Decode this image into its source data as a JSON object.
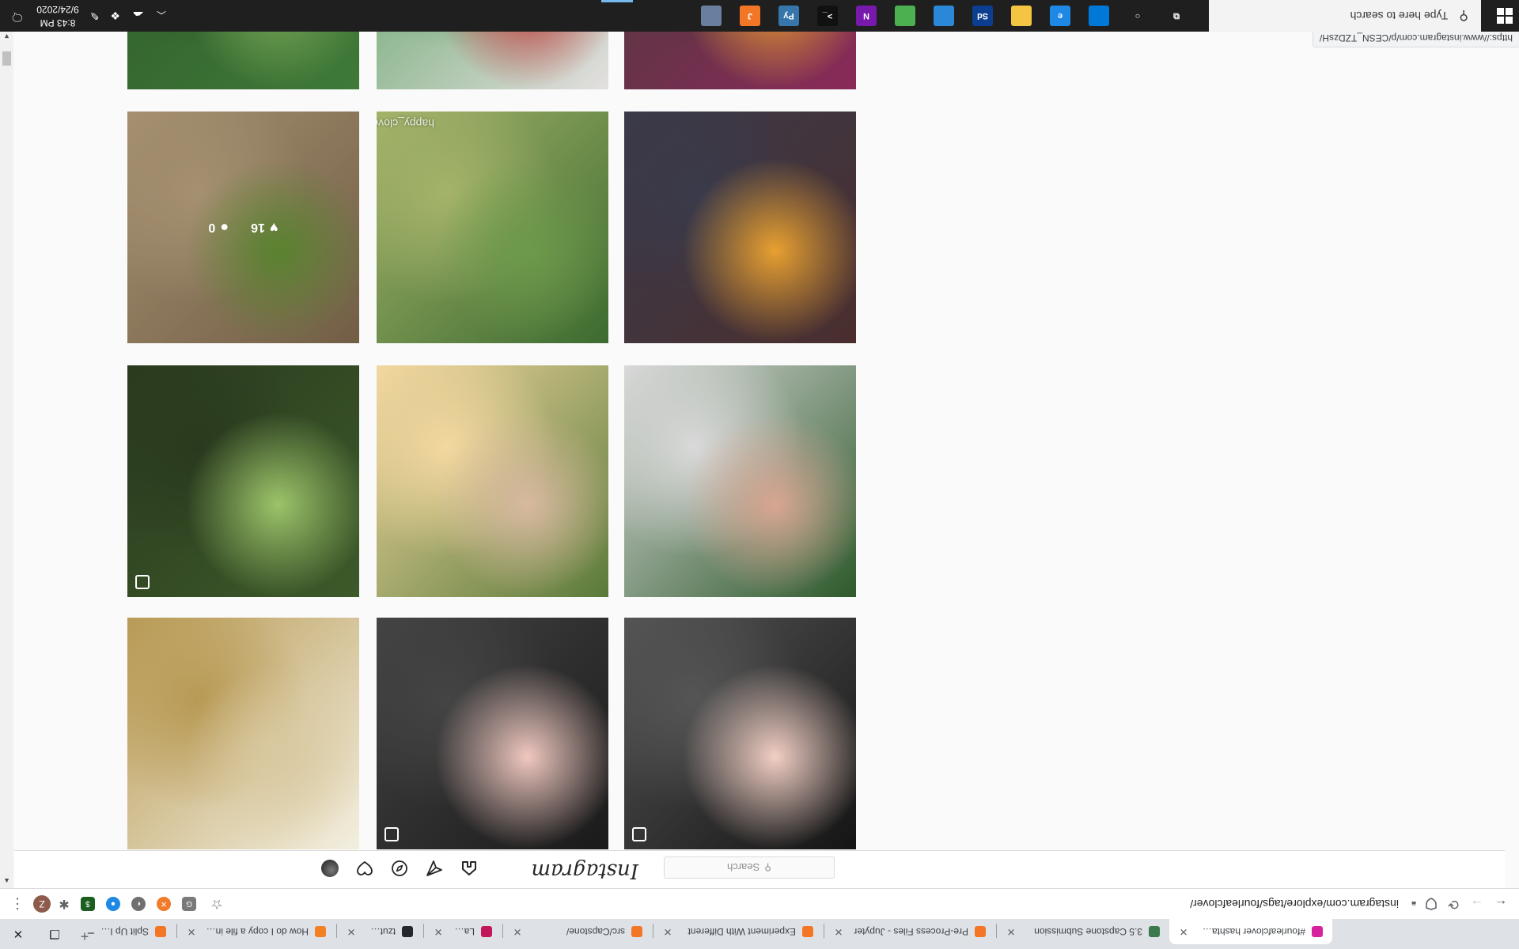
{
  "browser": {
    "tabs": [
      {
        "title": "#fourleafclover hashtag on",
        "favicon_color": "#d6249f",
        "active": true
      },
      {
        "title": "3.5 Capstone Submission",
        "favicon_color": "#3c7a4d",
        "active": false
      },
      {
        "title": "Pre-Process Files - Jupyter",
        "favicon_color": "#f37626",
        "active": false
      },
      {
        "title": "Experiment With Different",
        "favicon_color": "#f37626",
        "active": false
      },
      {
        "title": "src/Capstone/",
        "favicon_color": "#f37626",
        "active": false
      },
      {
        "title": "Label",
        "favicon_color": "#c2185b",
        "active": false
      },
      {
        "title": "tzutalin/labelImg: LabelImg",
        "favicon_color": "#24292e",
        "active": false
      },
      {
        "title": "How do I copy a file in Pyth",
        "favicon_color": "#f48024",
        "active": false
      },
      {
        "title": "Split Up Images - Jupyter N",
        "favicon_color": "#f37626",
        "active": false
      }
    ],
    "window_controls": {
      "minimize": "–",
      "maximize": "❐",
      "close": "✕"
    },
    "address_bar": {
      "url": "instagram.com/explore/tags/fourleafclover/"
    },
    "profile_initial": "Z",
    "status_url": "https://www.instagram.com/p/CESN_TZDzsH/"
  },
  "instagram": {
    "logo": "Instagram",
    "search_placeholder": "Search",
    "posts": [
      {
        "colors": [
          "#f3efe0",
          "#d9c9a0",
          "#b89a55"
        ],
        "multi": false
      },
      {
        "colors": [
          "#1a1a1a",
          "#f0c8c0",
          "#444"
        ],
        "multi": true
      },
      {
        "colors": [
          "#151515",
          "#f2cfc4",
          "#555"
        ],
        "multi": true
      },
      {
        "colors": [
          "#3d5a2a",
          "#9cc46a",
          "#2a3a1e"
        ],
        "multi": true
      },
      {
        "colors": [
          "#5a7a3a",
          "#d8b9a0",
          "#f3d8a0"
        ],
        "multi": false
      },
      {
        "colors": [
          "#2e5a2c",
          "#d8a692",
          "#d9d9d9"
        ],
        "multi": false
      },
      {
        "colors": [
          "#8b7355",
          "#6da03a",
          "#c9b08a"
        ],
        "multi": false,
        "likes": "16",
        "comments": "0"
      },
      {
        "colors": [
          "#3c6b30",
          "#6d9a4a",
          "#a5b36a"
        ],
        "multi": false,
        "caption": "happy_clover 4"
      },
      {
        "colors": [
          "#4a2e2e",
          "#e8a030",
          "#3a3a4a"
        ],
        "multi": false
      },
      {
        "colors": [
          "#3f7a38",
          "#7aa858",
          "#2e5a2a"
        ],
        "multi": false
      },
      {
        "colors": [
          "#e4dfe0",
          "#c03a3a",
          "#5aa060"
        ],
        "multi": false
      },
      {
        "colors": [
          "#8a2a5a",
          "#e89a30",
          "#4a3a3a"
        ],
        "multi": false
      }
    ]
  },
  "taskbar": {
    "search_placeholder": "Type here to search",
    "clock_time": "8:43 PM",
    "clock_date": "9/24/2020",
    "pinned": [
      {
        "name": "task-view",
        "color": "transparent",
        "glyph": "⧉"
      },
      {
        "name": "cortana",
        "color": "transparent",
        "glyph": "○"
      },
      {
        "name": "windows-store",
        "color": "#0078d7",
        "glyph": ""
      },
      {
        "name": "edge",
        "color": "#1e88e5",
        "glyph": "e"
      },
      {
        "name": "file-explorer",
        "color": "#f4c542",
        "glyph": ""
      },
      {
        "name": "photoshop",
        "color": "#0b3d91",
        "glyph": "Sd"
      },
      {
        "name": "photos",
        "color": "#2b88d8",
        "glyph": ""
      },
      {
        "name": "chrome",
        "color": "#4caf50",
        "glyph": ""
      },
      {
        "name": "onenote",
        "color": "#7719aa",
        "glyph": "N"
      },
      {
        "name": "terminal",
        "color": "#111111",
        "glyph": ">_"
      },
      {
        "name": "python",
        "color": "#3776ab",
        "glyph": "Py"
      },
      {
        "name": "jupyter",
        "color": "#f37626",
        "glyph": "J"
      },
      {
        "name": "calculator",
        "color": "#6a7fa0",
        "glyph": ""
      }
    ]
  }
}
